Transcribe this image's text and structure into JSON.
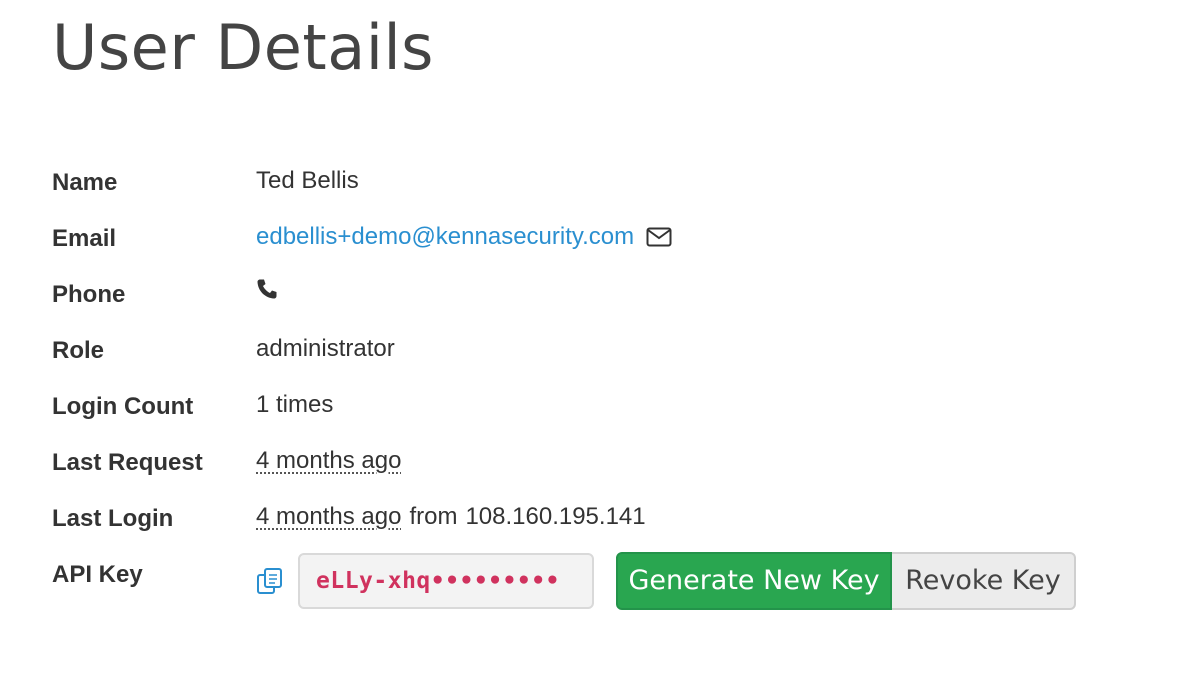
{
  "page": {
    "title": "User Details"
  },
  "details": {
    "name": {
      "label": "Name",
      "value": "Ted Bellis"
    },
    "email": {
      "label": "Email",
      "value": "edbellis+demo@kennasecurity.com",
      "icon": "envelope-icon"
    },
    "phone": {
      "label": "Phone",
      "icon": "phone-icon"
    },
    "role": {
      "label": "Role",
      "value": "administrator"
    },
    "login_count": {
      "label": "Login Count",
      "value": "1 times"
    },
    "last_request": {
      "label": "Last Request",
      "value": "4 months ago"
    },
    "last_login": {
      "label": "Last Login",
      "relative": "4 months ago",
      "from_text": "from",
      "ip": "108.160.195.141"
    },
    "api_key": {
      "label": "API Key",
      "copy_icon": "copy-icon",
      "masked_value": "eLLy-xhq•••••••••",
      "generate_label": "Generate New Key",
      "revoke_label": "Revoke Key"
    }
  },
  "colors": {
    "link": "#2a8fd0",
    "primary_button": "#29a650",
    "api_key_text": "#d0325e"
  }
}
